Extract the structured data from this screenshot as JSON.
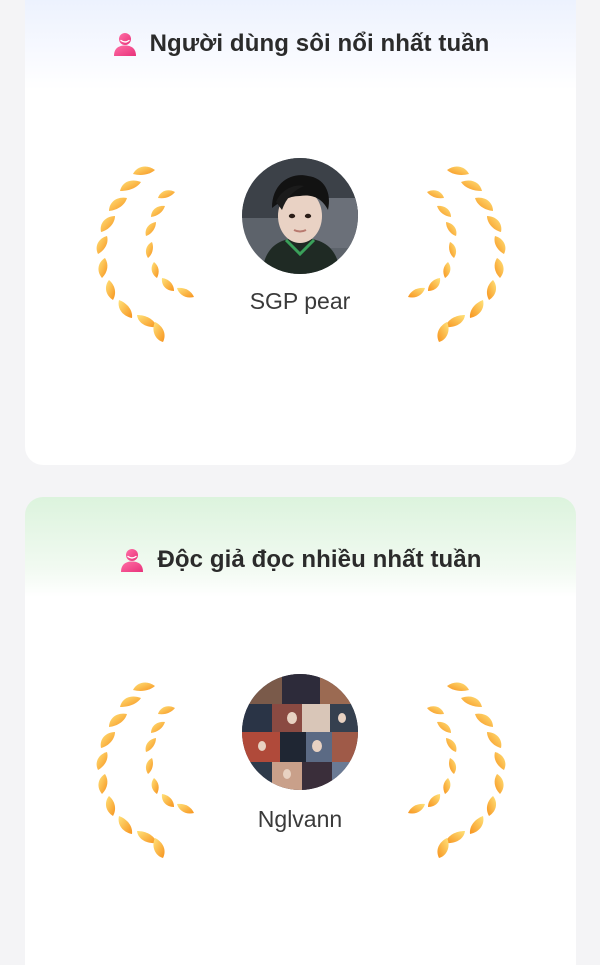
{
  "cards": [
    {
      "title": "Người dùng sôi nổi nhất tuần",
      "icon": "person-icon",
      "header_tint": "#e8effd",
      "user": {
        "name": "SGP pear",
        "avatar": "avatar-photo-portrait"
      }
    },
    {
      "title": "Độc giả đọc nhiều nhất tuần",
      "icon": "person-icon",
      "header_tint": "#dcf3dd",
      "user": {
        "name": "Nglvann",
        "avatar": "avatar-photo-collage"
      }
    }
  ],
  "colors": {
    "icon_pink": "#f0508a",
    "laurel_light": "#ffd54a",
    "laurel_dark": "#f7931e"
  }
}
